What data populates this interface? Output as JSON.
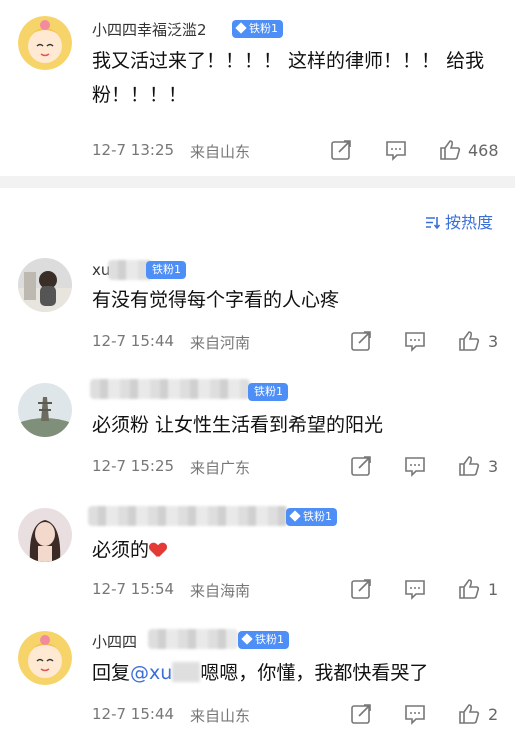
{
  "comments": [
    {
      "username": "小四四幸福泛滥2",
      "badge": "铁粉1",
      "text": "我又活过来了！！！！ 这样的律师！！！ 给我粉！！！！",
      "date": "12-7 13:25",
      "location": "来自山东",
      "likes": "468"
    },
    {
      "username": "xu",
      "badge": "铁粉1",
      "text": "有没有觉得每个字看的人心疼",
      "date": "12-7 15:44",
      "location": "来自河南",
      "likes": "3"
    },
    {
      "username": "",
      "badge": "铁粉1",
      "text": "必须粉 让女性生活看到希望的阳光",
      "date": "12-7 15:25",
      "location": "来自广东",
      "likes": "3"
    },
    {
      "username": "",
      "badge": "铁粉1",
      "text": "必须的",
      "date": "12-7 15:54",
      "location": "来自海南",
      "likes": "1"
    },
    {
      "username": "小四四",
      "badge": "铁粉1",
      "text_prefix": "回复",
      "mention": "@xu",
      "text": "嗯嗯，你懂，我都快看哭了",
      "date": "12-7 15:44",
      "location": "来自山东",
      "likes": "2"
    }
  ],
  "sort": {
    "label": "按热度"
  }
}
